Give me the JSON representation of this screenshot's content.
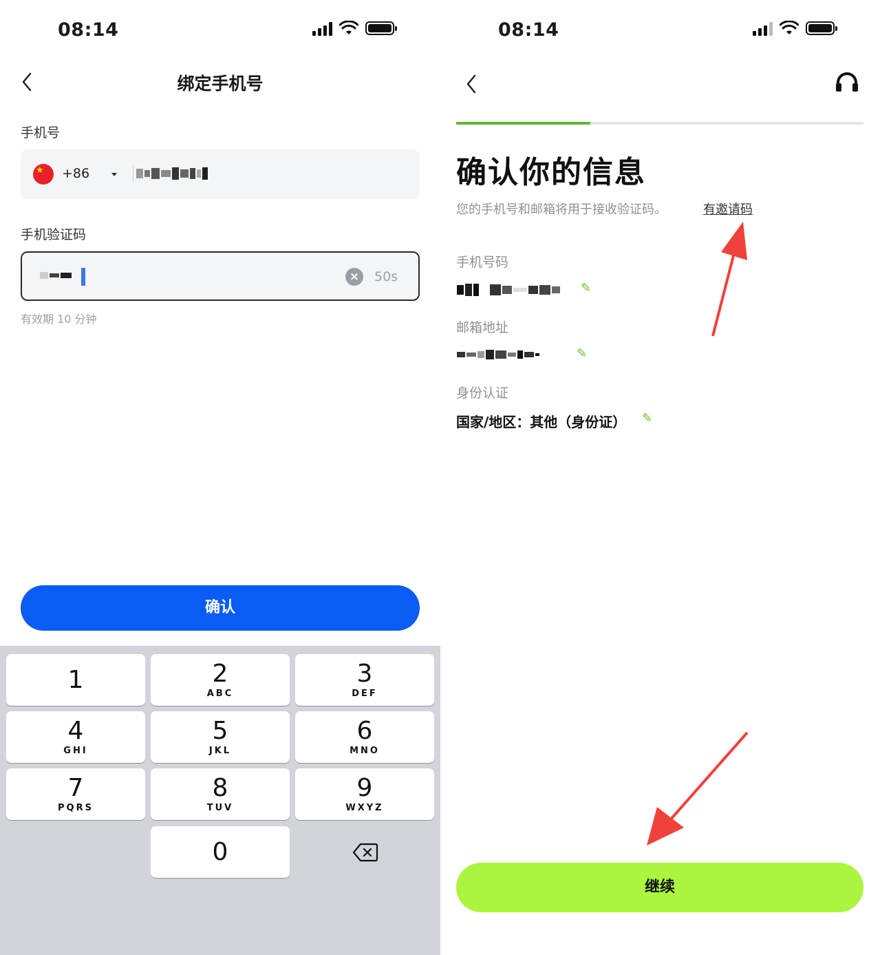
{
  "left_screen": {
    "status_time": "08:14",
    "nav_title": "绑定手机号",
    "phone_label": "手机号",
    "country_code": "+86",
    "code_label": "手机验证码",
    "countdown": "50s",
    "validity_hint": "有效期 10 分钟",
    "confirm_button": "确认",
    "keypad": [
      {
        "num": "1",
        "letters": ""
      },
      {
        "num": "2",
        "letters": "ABC"
      },
      {
        "num": "3",
        "letters": "DEF"
      },
      {
        "num": "4",
        "letters": "GHI"
      },
      {
        "num": "5",
        "letters": "JKL"
      },
      {
        "num": "6",
        "letters": "MNO"
      },
      {
        "num": "7",
        "letters": "PQRS"
      },
      {
        "num": "8",
        "letters": "TUV"
      },
      {
        "num": "9",
        "letters": "WXYZ"
      },
      {
        "num": "0",
        "letters": ""
      }
    ]
  },
  "right_screen": {
    "status_time": "08:14",
    "progress": 0.33,
    "title": "确认你的信息",
    "description": "您的手机号和邮箱将用于接收验证码。",
    "invite_link": "有邀请码",
    "phone_label": "手机号码",
    "email_label": "邮箱地址",
    "identity_label": "身份认证",
    "identity_value": "国家/地区：其他（身份证）",
    "continue_button": "继续"
  },
  "colors": {
    "confirm_blue": "#0a5cf5",
    "continue_green": "#acf53f",
    "progress_green": "#62b531",
    "annotation_arrow": "#f0413c"
  }
}
